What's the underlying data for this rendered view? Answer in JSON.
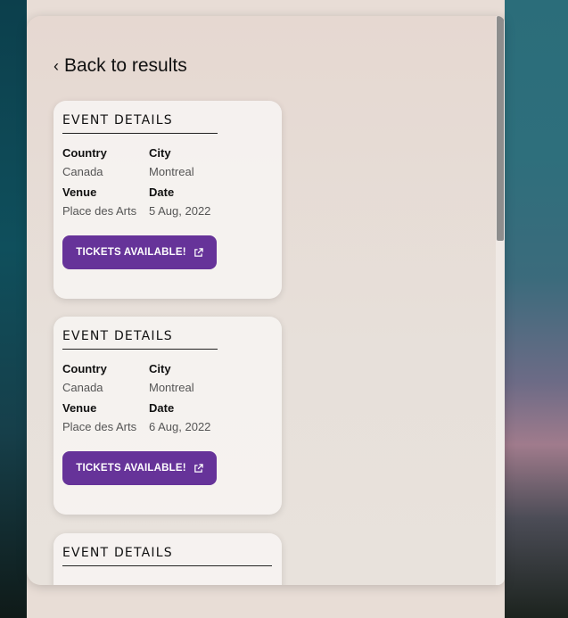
{
  "back_link": {
    "label": "Back to results"
  },
  "events": [
    {
      "title": "EVENT DETAILS",
      "country_label": "Country",
      "country": "Canada",
      "city_label": "City",
      "city": "Montreal",
      "venue_label": "Venue",
      "venue": "Place des Arts",
      "date_label": "Date",
      "date": "5 Aug, 2022",
      "button": "TICKETS AVAILABLE!"
    },
    {
      "title": "EVENT DETAILS",
      "country_label": "Country",
      "country": "Canada",
      "city_label": "City",
      "city": "Montreal",
      "venue_label": "Venue",
      "venue": "Place des Arts",
      "date_label": "Date",
      "date": "6 Aug, 2022",
      "button": "TICKETS AVAILABLE!"
    },
    {
      "title": "EVENT DETAILS"
    }
  ],
  "colors": {
    "accent": "#663399",
    "panel": "#e8ddd6"
  },
  "icons": {
    "back": "chevron-left-icon",
    "external": "external-link-icon"
  }
}
